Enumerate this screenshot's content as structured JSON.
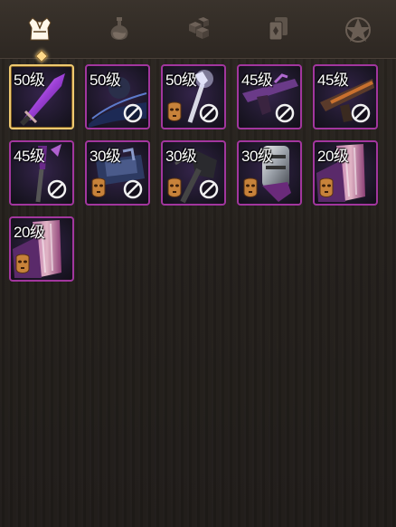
{
  "tabs": [
    {
      "name": "armor-tab",
      "icon": "armor-icon",
      "active": true
    },
    {
      "name": "potion-tab",
      "icon": "potion-icon",
      "active": false
    },
    {
      "name": "cubes-tab",
      "icon": "cubes-icon",
      "active": false
    },
    {
      "name": "cards-tab",
      "icon": "cards-icon",
      "active": false
    },
    {
      "name": "pentagram-tab",
      "icon": "pentagram-icon",
      "active": false
    }
  ],
  "colors": {
    "accent": "#d7ae62",
    "slot_border": "#a2369e",
    "selected_border": "#efc970"
  },
  "items": [
    {
      "level": "50级",
      "art": "purple-blade-icon",
      "restricted": false,
      "mask": false,
      "selected": true
    },
    {
      "level": "50级",
      "art": "dark-sword-icon",
      "restricted": true,
      "mask": false
    },
    {
      "level": "50级",
      "art": "white-staff-icon",
      "restricted": true,
      "mask": true
    },
    {
      "level": "45级",
      "art": "purple-gun-icon",
      "restricted": true,
      "mask": false
    },
    {
      "level": "45级",
      "art": "orange-gun-icon",
      "restricted": true,
      "mask": false
    },
    {
      "level": "45级",
      "art": "purple-spear-icon",
      "restricted": true,
      "mask": false
    },
    {
      "level": "30级",
      "art": "blue-armor-icon",
      "restricted": true,
      "mask": true
    },
    {
      "level": "30级",
      "art": "black-axe-icon",
      "restricted": true,
      "mask": true
    },
    {
      "level": "30级",
      "art": "steel-gauntlet-icon",
      "restricted": false,
      "mask": true
    },
    {
      "level": "20级",
      "art": "purple-cape-icon",
      "restricted": false,
      "mask": true
    },
    {
      "level": "20级",
      "art": "purple-cape-icon",
      "restricted": false,
      "mask": true
    }
  ]
}
